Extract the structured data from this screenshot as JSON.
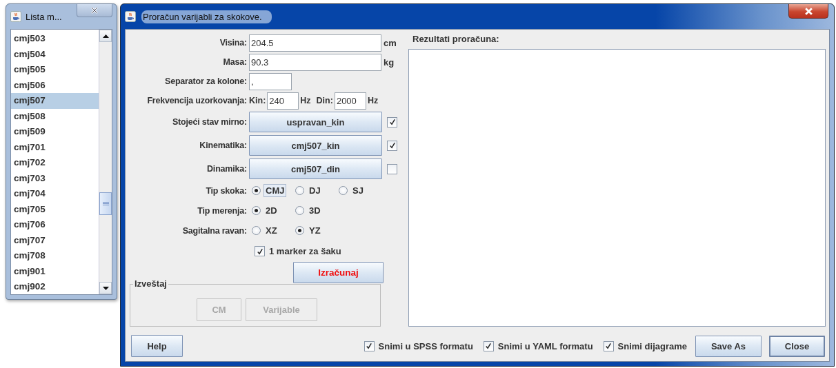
{
  "list_window": {
    "title": "Lista m...",
    "items": [
      {
        "label": "cmj503",
        "selected": false
      },
      {
        "label": "cmj504",
        "selected": false
      },
      {
        "label": "cmj505",
        "selected": false
      },
      {
        "label": "cmj506",
        "selected": false
      },
      {
        "label": "cmj507",
        "selected": true
      },
      {
        "label": "cmj508",
        "selected": false
      },
      {
        "label": "cmj509",
        "selected": false
      },
      {
        "label": "cmj701",
        "selected": false
      },
      {
        "label": "cmj702",
        "selected": false
      },
      {
        "label": "cmj703",
        "selected": false
      },
      {
        "label": "cmj704",
        "selected": false
      },
      {
        "label": "cmj705",
        "selected": false
      },
      {
        "label": "cmj706",
        "selected": false
      },
      {
        "label": "cmj707",
        "selected": false
      },
      {
        "label": "cmj708",
        "selected": false
      },
      {
        "label": "cmj901",
        "selected": false
      },
      {
        "label": "cmj902",
        "selected": false
      }
    ]
  },
  "main_window": {
    "title": "Proračun varijabli za skokove.",
    "fields": [
      {
        "label": "Visina:",
        "value": "204.5",
        "unit": "cm",
        "kind": "wide"
      },
      {
        "label": "Masa:",
        "value": "90.3",
        "unit": "kg",
        "kind": "wide"
      },
      {
        "label": "Separator za kolone:",
        "value": ",",
        "kind": "short"
      }
    ],
    "sampling": {
      "label": "Frekvencija uzorkovanja:",
      "kin_label": "Kin:",
      "kin_value": "240",
      "kin_unit": "Hz",
      "din_label": "Din:",
      "din_value": "2000",
      "din_unit": "Hz"
    },
    "file_rows": [
      {
        "label": "Stojeći stav mirno:",
        "button": "uspravan_kin",
        "checked": true
      },
      {
        "label": "Kinematika:",
        "button": "cmj507_kin",
        "checked": true
      },
      {
        "label": "Dinamika:",
        "button": "cmj507_din",
        "checked": false
      }
    ],
    "radio_groups": [
      {
        "label": "Tip skoka:",
        "options": [
          {
            "label": "CMJ",
            "selected": true,
            "focused": true
          },
          {
            "label": "DJ",
            "selected": false,
            "focused": false
          },
          {
            "label": "SJ",
            "selected": false,
            "focused": false
          }
        ]
      },
      {
        "label": "Tip merenja:",
        "options": [
          {
            "label": "2D",
            "selected": true,
            "focused": false
          },
          {
            "label": "3D",
            "selected": false,
            "focused": false
          }
        ]
      },
      {
        "label": "Sagitalna ravan:",
        "options": [
          {
            "label": "XZ",
            "selected": false,
            "focused": false
          },
          {
            "label": "YZ",
            "selected": true,
            "focused": false
          }
        ]
      }
    ],
    "marker_checkbox": {
      "label": "1 marker za šaku",
      "checked": true
    },
    "calculate_button": "Izračunaj",
    "report": {
      "title": "Izveštaj",
      "buttons": [
        {
          "label": "CM",
          "disabled": true
        },
        {
          "label": "Varijable",
          "disabled": true
        }
      ]
    },
    "results": {
      "label": "Rezultati proračuna:"
    },
    "footer": {
      "help_button": "Help",
      "checkboxes": [
        {
          "label": "Snimi u SPSS formatu",
          "checked": true
        },
        {
          "label": "Snimi u YAML formatu",
          "checked": true
        },
        {
          "label": "Snimi dijagrame",
          "checked": true
        }
      ],
      "buttons": [
        "Save As",
        "Close"
      ]
    }
  }
}
